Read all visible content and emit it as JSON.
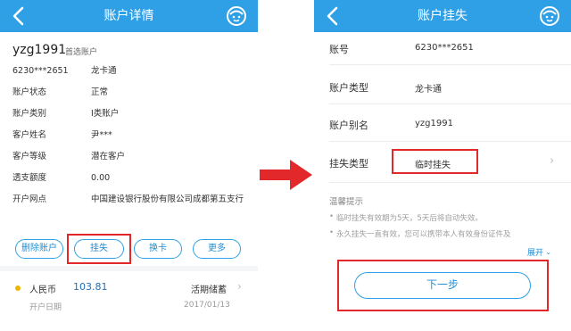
{
  "left": {
    "header": {
      "title": "账户详情"
    },
    "account": {
      "name": "yzg1991",
      "default_tag": "首选账户"
    },
    "rows": [
      {
        "label": "6230***2651",
        "value": "龙卡通"
      },
      {
        "label": "账户状态",
        "value": "正常"
      },
      {
        "label": "账户类别",
        "value": "I类账户"
      },
      {
        "label": "客户姓名",
        "value": "尹***"
      },
      {
        "label": "客户等级",
        "value": "潜在客户"
      },
      {
        "label": "透支额度",
        "value": "0.00"
      },
      {
        "label": "开户网点",
        "value": "中国建设银行股份有限公司成都第五支行"
      }
    ],
    "buttons": {
      "delete": "删除账户",
      "report_loss": "挂失",
      "change_card": "换卡",
      "more": "更多"
    },
    "balance": {
      "currency": "人民币",
      "amount": "103.81",
      "type": "活期储蓄",
      "open_date_label": "开户日期",
      "open_date": "2017/01/13"
    }
  },
  "right": {
    "header": {
      "title": "账户挂失"
    },
    "fields": [
      {
        "label": "账号",
        "value": "6230***2651"
      },
      {
        "label": "账户类型",
        "value": "龙卡通"
      },
      {
        "label": "账户别名",
        "value": "yzg1991"
      },
      {
        "label": "挂失类型",
        "value": "临时挂失"
      }
    ],
    "hints": {
      "title": "温馨提示",
      "items": [
        "临时挂失有效期为5天，5天后将自动失效。",
        "永久挂失一直有效，您可以携带本人有效身份证件及"
      ],
      "expand": "展开"
    },
    "next_button": "下一步"
  },
  "colors": {
    "brand_blue": "#2fa0e6",
    "highlight_red": "#e3282c"
  }
}
